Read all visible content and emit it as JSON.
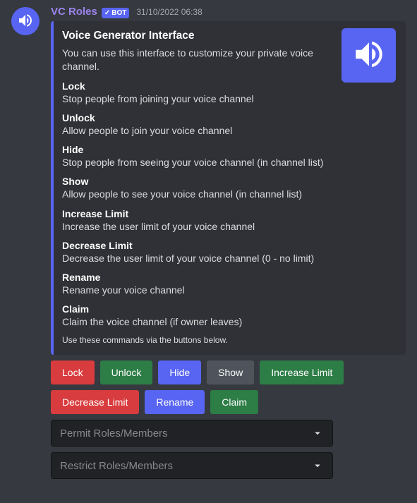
{
  "author": {
    "name": "VC Roles",
    "bot_label": "BOT",
    "timestamp": "31/10/2022 06:38"
  },
  "embed": {
    "title": "Voice Generator Interface",
    "description": "You can use this interface to customize your private voice channel.",
    "fields": [
      {
        "name": "Lock",
        "value": "Stop people from joining your voice channel"
      },
      {
        "name": "Unlock",
        "value": "Allow people to join your voice channel"
      },
      {
        "name": "Hide",
        "value": "Stop people from seeing your voice channel (in channel list)"
      },
      {
        "name": "Show",
        "value": "Allow people to see your voice channel (in channel list)"
      },
      {
        "name": "Increase Limit",
        "value": "Increase the user limit of your voice channel"
      },
      {
        "name": "Decrease Limit",
        "value": "Decrease the user limit of your voice channel (0 - no limit)"
      },
      {
        "name": "Rename",
        "value": "Rename your voice channel"
      },
      {
        "name": "Claim",
        "value": "Claim the voice channel (if owner leaves)"
      }
    ],
    "footer": "Use these commands via the buttons below."
  },
  "buttons_row1": [
    {
      "label": "Lock",
      "style": "red",
      "key": "lock"
    },
    {
      "label": "Unlock",
      "style": "green",
      "key": "unlock"
    },
    {
      "label": "Hide",
      "style": "blurple",
      "key": "hide"
    },
    {
      "label": "Show",
      "style": "grey",
      "key": "show"
    },
    {
      "label": "Increase Limit",
      "style": "green",
      "key": "increase-limit"
    }
  ],
  "buttons_row2": [
    {
      "label": "Decrease Limit",
      "style": "red",
      "key": "decrease-limit"
    },
    {
      "label": "Rename",
      "style": "blurple",
      "key": "rename"
    },
    {
      "label": "Claim",
      "style": "green",
      "key": "claim"
    }
  ],
  "selects": [
    {
      "placeholder": "Permit Roles/Members",
      "key": "permit"
    },
    {
      "placeholder": "Restrict Roles/Members",
      "key": "restrict"
    }
  ],
  "colors": {
    "accent": "#5865f2",
    "red": "#d83c3e",
    "green": "#2d7d46",
    "grey": "#4f545c"
  }
}
